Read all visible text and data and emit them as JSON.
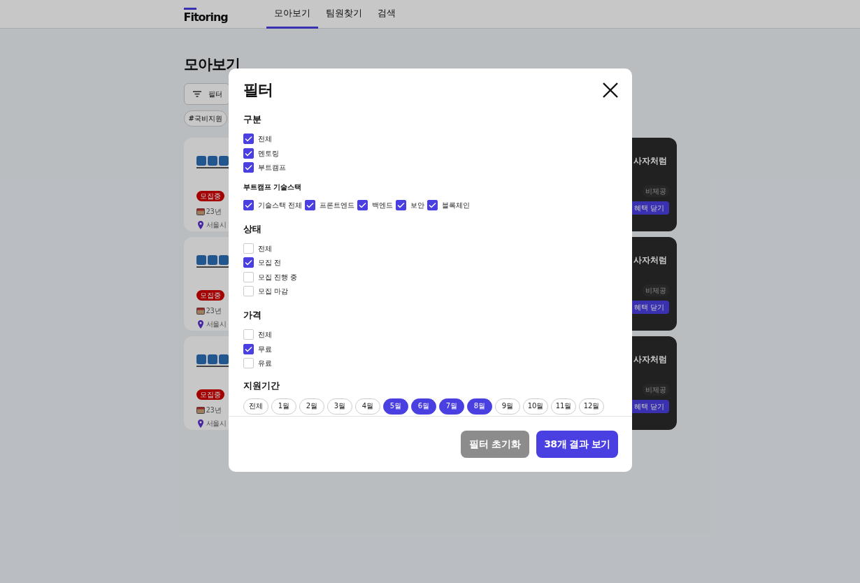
{
  "nav": {
    "logo": "Fitoring",
    "tabs": [
      {
        "label": "모아보기",
        "selected": true
      },
      {
        "label": "팀원찾기",
        "selected": false
      },
      {
        "label": "검색",
        "selected": false
      }
    ]
  },
  "page": {
    "title": "모아보기",
    "filter_button": "필터",
    "tags": [
      "#국비지원"
    ],
    "cards": [
      {
        "status": "모집중",
        "date": "23년",
        "location": "서울시",
        "title": "사자처럼",
        "tag": "비제공",
        "button": "혜택 닫기"
      },
      {
        "status": "모집중",
        "date": "23년",
        "location": "서울시",
        "title": "사자처럼",
        "tag": "비제공",
        "button": "혜택 닫기"
      },
      {
        "status": "모집중",
        "date": "23년",
        "location": "서울시",
        "title": "사자처럼",
        "tag": "비제공",
        "button": "혜택 닫기"
      }
    ]
  },
  "modal": {
    "title": "필터",
    "sections": [
      {
        "kind": "list",
        "title": "구분",
        "options": [
          {
            "label": "전체",
            "checked": true
          },
          {
            "label": "멘토링",
            "checked": true
          },
          {
            "label": "부트캠프",
            "checked": true
          }
        ]
      },
      {
        "kind": "inline",
        "title": "부트캠프 기술스택",
        "options": [
          {
            "label": "기술스택 전체",
            "checked": true
          },
          {
            "label": "프론트엔드",
            "checked": true
          },
          {
            "label": "백엔드",
            "checked": true
          },
          {
            "label": "보안",
            "checked": true
          },
          {
            "label": "블록체인",
            "checked": true
          }
        ]
      },
      {
        "kind": "list",
        "title": "상태",
        "options": [
          {
            "label": "전체",
            "checked": false
          },
          {
            "label": "모집 전",
            "checked": true
          },
          {
            "label": "모집 진행 중",
            "checked": false
          },
          {
            "label": "모집 마감",
            "checked": false
          }
        ]
      },
      {
        "kind": "list",
        "title": "가격",
        "options": [
          {
            "label": "전체",
            "checked": false
          },
          {
            "label": "무료",
            "checked": true
          },
          {
            "label": "유료",
            "checked": false
          }
        ]
      },
      {
        "kind": "months",
        "title": "지원기간",
        "options": [
          {
            "label": "전체",
            "selected": false
          },
          {
            "label": "1월",
            "selected": false
          },
          {
            "label": "2월",
            "selected": false
          },
          {
            "label": "3월",
            "selected": false
          },
          {
            "label": "4월",
            "selected": false
          },
          {
            "label": "5월",
            "selected": true
          },
          {
            "label": "6월",
            "selected": true
          },
          {
            "label": "7월",
            "selected": true
          },
          {
            "label": "8월",
            "selected": true
          },
          {
            "label": "9월",
            "selected": false
          },
          {
            "label": "10월",
            "selected": false
          },
          {
            "label": "11월",
            "selected": false
          },
          {
            "label": "12월",
            "selected": false
          }
        ]
      }
    ],
    "reset_button": "필터 초기화",
    "apply_button": "38개 결과 보기"
  }
}
